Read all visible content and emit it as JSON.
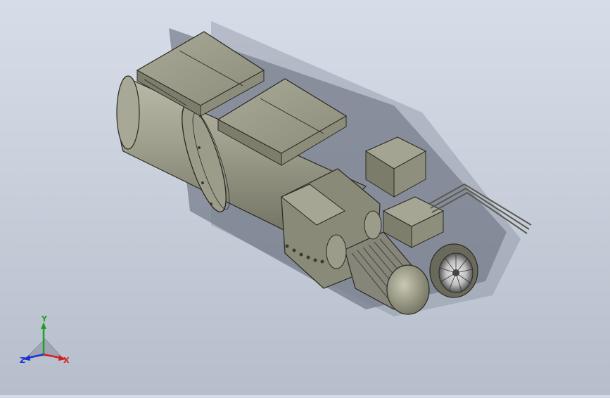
{
  "viewport": {
    "background_top": "#d7dde8",
    "background_bottom": "#b6becb",
    "model_body_color": "#9a9a86",
    "model_shadow_color": "#5c6270"
  },
  "triad": {
    "x_label": "X",
    "y_label": "Y",
    "z_label": "Z",
    "x_color": "#d42020",
    "y_color": "#20a020",
    "z_color": "#2030d0"
  }
}
